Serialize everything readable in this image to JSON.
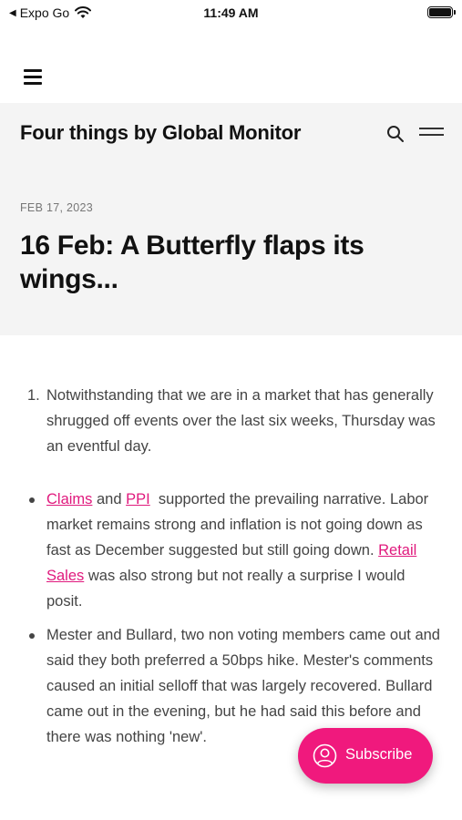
{
  "status_bar": {
    "back_label": "Expo Go",
    "time": "11:49 AM"
  },
  "header": {
    "site_title": "Four things by Global Monitor",
    "post_date": "FEB 17, 2023",
    "post_title": "16 Feb: A Butterfly flaps its wings..."
  },
  "content": {
    "numbered_item": {
      "marker": "1.",
      "text": "Notwithstanding that we are in a market that has generally shrugged off events over the last six weeks, Thursday was an eventful day."
    },
    "bullet_1": {
      "link_claims": "Claims",
      "and": " and ",
      "link_ppi": "PPI",
      "text_a": "  supported the prevailing narrative. Labor market remains strong and inflation is not going down as fast as December suggested but still going down. ",
      "link_retail": "Retail Sales",
      "text_b": " was also strong but not really a surprise I would posit."
    },
    "bullet_2": {
      "text": "Mester and Bullard, two non voting members came out and said they both preferred a 50bps hike. Mester's comments caused an initial selloff that was largely recovered. Bullard came out in the evening, but he had said this before and there was nothing 'new'."
    }
  },
  "subscribe": {
    "label": "Subscribe"
  },
  "colors": {
    "accent": "#f0197d",
    "link": "#e0197d",
    "header_bg": "#f4f4f4"
  }
}
